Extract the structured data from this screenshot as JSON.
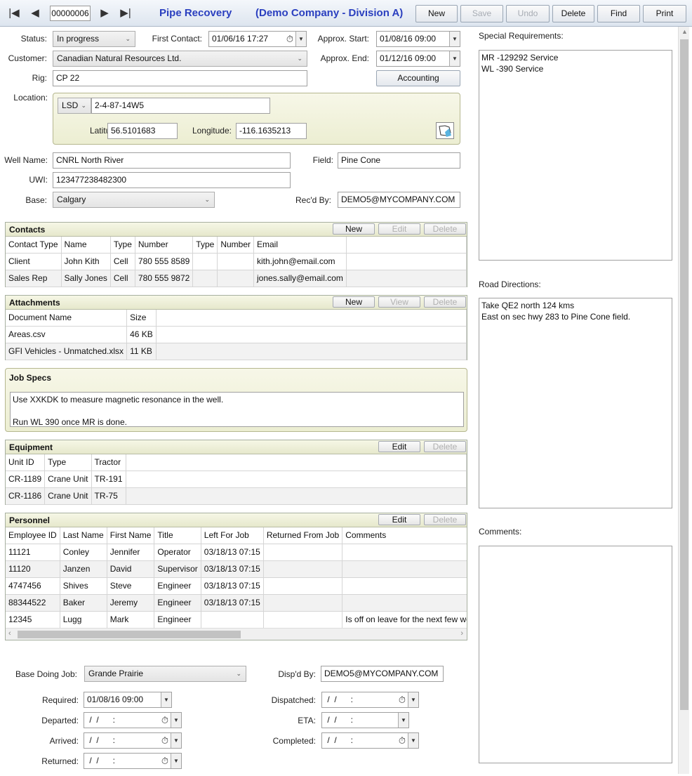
{
  "toolbar": {
    "record_number": "00000006",
    "app_title": "Pipe Recovery",
    "company": "(Demo Company - Division A)",
    "new_label": "New",
    "save_label": "Save",
    "undo_label": "Undo",
    "delete_label": "Delete",
    "find_label": "Find",
    "print_label": "Print"
  },
  "form": {
    "status_label": "Status:",
    "status_value": "In progress",
    "first_contact_label": "First Contact:",
    "first_contact_value": "01/06/16 17:27",
    "approx_start_label": "Approx. Start:",
    "approx_start_value": "01/08/16 09:00",
    "customer_label": "Customer:",
    "customer_value": "Canadian Natural Resources Ltd.",
    "approx_end_label": "Approx. End:",
    "approx_end_value": "01/12/16 09:00",
    "rig_label": "Rig:",
    "rig_value": "CP 22",
    "accounting_label": "Accounting",
    "location_label": "Location:",
    "loc_type": "LSD",
    "loc_value": "2-4-87-14W5",
    "latitude_label": "Latitude:",
    "latitude_value": "56.5101683",
    "longitude_label": "Longitude:",
    "longitude_value": "-116.1635213",
    "well_name_label": "Well Name:",
    "well_name_value": "CNRL North River",
    "field_label": "Field:",
    "field_value": "Pine Cone",
    "uwi_label": "UWI:",
    "uwi_value": "123477238482300",
    "base_label": "Base:",
    "base_value": "Calgary",
    "recd_by_label": "Rec'd By:",
    "recd_by_value": "DEMO5@MYCOMPANY.COM"
  },
  "contacts": {
    "title": "Contacts",
    "new_label": "New",
    "edit_label": "Edit",
    "delete_label": "Delete",
    "columns": [
      "Contact Type",
      "Name",
      "Type",
      "Number",
      "Type",
      "Number",
      "Email"
    ],
    "rows": [
      [
        "Client",
        "John Kith",
        "Cell",
        "780 555 8589",
        "",
        "",
        "kith.john@email.com"
      ],
      [
        "Sales Rep",
        "Sally Jones",
        "Cell",
        "780 555 9872",
        "",
        "",
        "jones.sally@email.com"
      ]
    ]
  },
  "attachments": {
    "title": "Attachments",
    "new_label": "New",
    "view_label": "View",
    "delete_label": "Delete",
    "columns": [
      "Document Name",
      "Size"
    ],
    "rows": [
      [
        "Areas.csv",
        "46 KB"
      ],
      [
        "GFI Vehicles - Unmatched.xlsx",
        "11 KB"
      ]
    ]
  },
  "job_specs": {
    "title": "Job Specs",
    "line1": "Use XXKDK to measure magnetic resonance in the well.",
    "line2": "Run WL 390 once MR is done."
  },
  "equipment": {
    "title": "Equipment",
    "edit_label": "Edit",
    "delete_label": "Delete",
    "columns": [
      "Unit ID",
      "Type",
      "Tractor"
    ],
    "rows": [
      [
        "CR-1189",
        "Crane Unit",
        "TR-191"
      ],
      [
        "CR-1186",
        "Crane Unit",
        "TR-75"
      ]
    ]
  },
  "personnel": {
    "title": "Personnel",
    "edit_label": "Edit",
    "delete_label": "Delete",
    "columns": [
      "Employee ID",
      "Last Name",
      "First Name",
      "Title",
      "Left For Job",
      "Returned From Job",
      "Comments"
    ],
    "rows": [
      [
        "11121",
        "Conley",
        "Jennifer",
        "Operator",
        "03/18/13 07:15",
        "",
        ""
      ],
      [
        "11120",
        "Janzen",
        "David",
        "Supervisor",
        "03/18/13 07:15",
        "",
        ""
      ],
      [
        "4747456",
        "Shives",
        "Steve",
        "Engineer",
        "03/18/13 07:15",
        "",
        ""
      ],
      [
        "88344522",
        "Baker",
        "Jeremy",
        "Engineer",
        "03/18/13 07:15",
        "",
        ""
      ],
      [
        "12345",
        "Lugg",
        "Mark",
        "Engineer",
        "",
        "",
        "Is off on leave for the next few weeks"
      ]
    ]
  },
  "dispatch": {
    "base_doing_job_label": "Base Doing Job:",
    "base_doing_job_value": "Grande Prairie",
    "dispd_by_label": "Disp'd By:",
    "dispd_by_value": "DEMO5@MYCOMPANY.COM",
    "required_label": "Required:",
    "required_value": "01/08/16 09:00",
    "dispatched_label": "Dispatched:",
    "dispatched_value": " /  /      :",
    "departed_label": "Departed:",
    "departed_value": " /  /      :",
    "eta_label": "ETA:",
    "eta_value": " /  /      :",
    "arrived_label": "Arrived:",
    "arrived_value": " /  /      :",
    "completed_label": "Completed:",
    "completed_value": " /  /      :",
    "returned_label": "Returned:",
    "returned_value": " /  /      :"
  },
  "right": {
    "special_req_label": "Special Requirements:",
    "special_req_text": "MR -129292 Service\nWL -390 Service",
    "road_dir_label": "Road Directions:",
    "road_dir_text": "Take QE2 north 124 kms\nEast on sec hwy 283 to Pine Cone field.",
    "comments_label": "Comments:",
    "comments_text": ""
  }
}
